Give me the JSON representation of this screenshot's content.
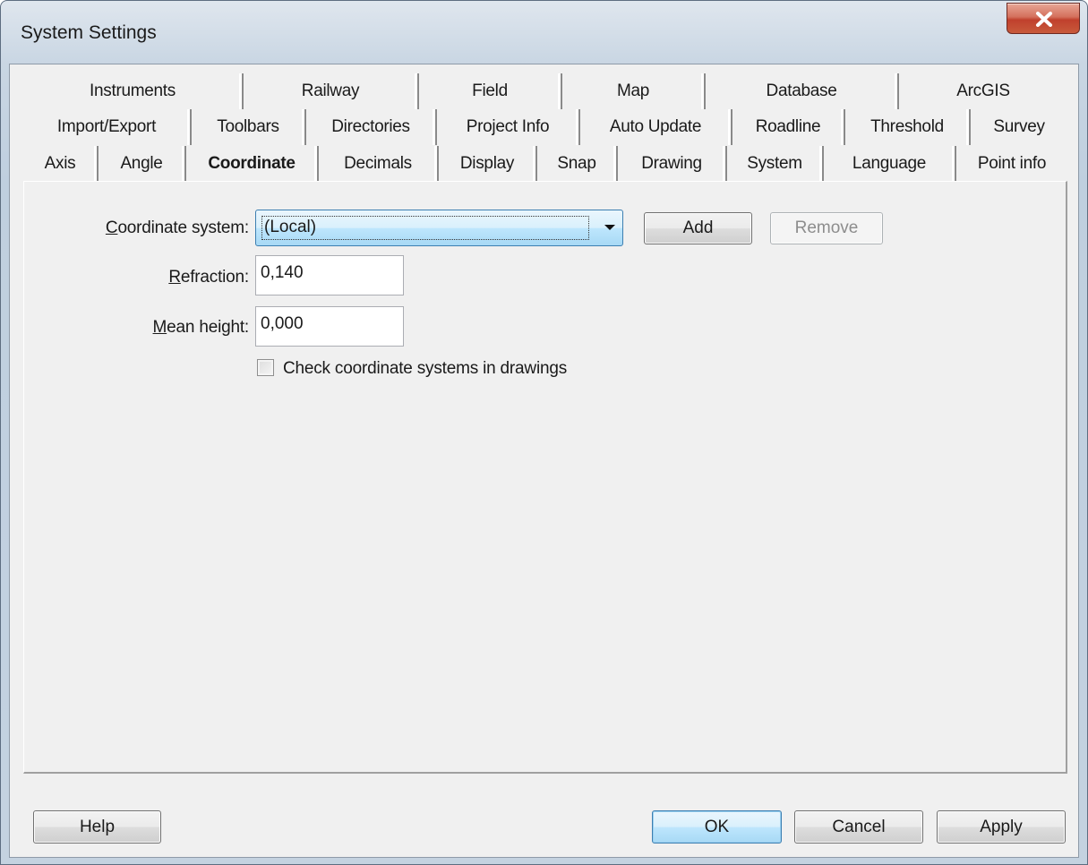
{
  "window": {
    "title": "System Settings"
  },
  "tabs": {
    "row1": [
      "Instruments",
      "Railway",
      "Field",
      "Map",
      "Database",
      "ArcGIS"
    ],
    "row2": [
      "Import/Export",
      "Toolbars",
      "Directories",
      "Project Info",
      "Auto Update",
      "Roadline",
      "Threshold",
      "Survey"
    ],
    "row3": [
      "Axis",
      "Angle",
      "Coordinate",
      "Decimals",
      "Display",
      "Snap",
      "Drawing",
      "System",
      "Language",
      "Point info"
    ],
    "active": "Coordinate"
  },
  "coordinate": {
    "coordinate_system_label_mnemonic": "C",
    "coordinate_system_label_rest": "oordinate system:",
    "coordinate_system_value": "(Local)",
    "add_label": "Add",
    "remove_label": "Remove",
    "refraction_label_mnemonic": "R",
    "refraction_label_rest": "efraction:",
    "refraction_value": "0,140",
    "mean_height_label_mnemonic": "M",
    "mean_height_label_rest": "ean height:",
    "mean_height_value": "0,000",
    "check_label": "Check coordinate systems in drawings",
    "check_checked": false
  },
  "footer": {
    "help_label": "Help",
    "ok_label": "OK",
    "cancel_label": "Cancel",
    "apply_label": "Apply"
  },
  "colors": {
    "close_button": "#c85a3c",
    "default_button": "#a7d9f5",
    "dialog_bg": "#f0f0f0"
  }
}
